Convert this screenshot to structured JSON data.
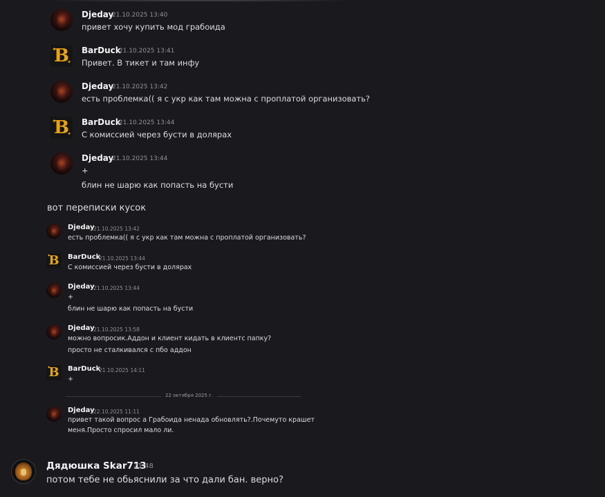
{
  "embedded_chat": {
    "messages": [
      {
        "author": "Djeday",
        "time": "21.10.2025 13:40",
        "lines": [
          "привет хочу купить мод грабоида"
        ]
      },
      {
        "author": "BarDuck",
        "time": "21.10.2025 13:41",
        "lines": [
          "Привет. В тикет и там инфу"
        ]
      },
      {
        "author": "Djeday",
        "time": "21.10.2025 13:42",
        "lines": [
          "есть проблемка(( я с укр как там можна с проплатой организовать?"
        ]
      },
      {
        "author": "BarDuck",
        "time": "21.10.2025 13:44",
        "lines": [
          "С комиссией через бусти в долярах"
        ]
      },
      {
        "author": "Djeday",
        "time": "21.10.2025 13:44",
        "lines": [
          "+",
          "блин не шарю как попасть на бусти"
        ]
      }
    ],
    "avatar_text": {
      "barduck_letter": "B",
      "barduck_label": "BarDuck"
    }
  },
  "caption": "вот переписки кусок",
  "embedded_chat_2": {
    "messages": [
      {
        "author": "Djeday",
        "time": "21.10.2025 13:42",
        "lines": [
          "есть проблемка(( я с укр как там можна с проплатой организовать?"
        ]
      },
      {
        "author": "BarDuck",
        "time": "21.10.2025 13:44",
        "lines": [
          "С комиссией через бусти в долярах"
        ]
      },
      {
        "author": "Djeday",
        "time": "21.10.2025 13:44",
        "lines": [
          "+",
          "блин не шарю как попасть на бусти"
        ]
      },
      {
        "author": "Djeday",
        "time": "21.10.2025 13:58",
        "lines": [
          "можно вопросик.Аддон и клиент кидать в клиентс папку?",
          "просто не сталкивался с пбо аддон"
        ]
      },
      {
        "author": "BarDuck",
        "time": "21.10.2025 14:11",
        "lines": [
          "+"
        ]
      },
      {
        "author": "Djeday",
        "time": "22.10.2025 11:11",
        "lines": [
          "привет такой вопрос а Грабоида ненада обновлять?.Почемуто крашет",
          "меня.Просто спросил мало ли."
        ]
      }
    ],
    "date_divider": "22 октября 2025 г."
  },
  "main_message": {
    "author": "Дядюшка Skar713",
    "time": "21:48",
    "text": "потом тебе не обьяснили за что дали бан. верно?"
  },
  "colors": {
    "background": "#1a1a1e",
    "name": "#f2f3f5",
    "text": "#dbdee1",
    "timestamp": "#8e9297",
    "barduck_gold": "#e8a418"
  },
  "icons": [
    "djeday-avatar-icon",
    "barduck-avatar-icon",
    "lion-avatar-icon"
  ]
}
